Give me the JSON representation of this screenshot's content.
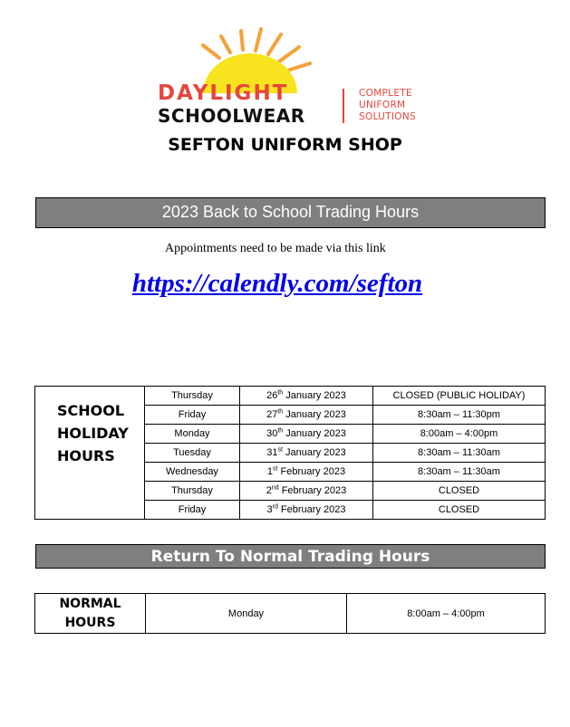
{
  "logo": {
    "brand_line1": "DAYLIGHT",
    "brand_line2": "SCHOOLWEAR",
    "tagline": [
      "COMPLETE",
      "UNIFORM",
      "SOLUTIONS"
    ],
    "colors": {
      "sun": "#f7e41f",
      "rays": "#f4a23a",
      "brand": "#e8453c"
    }
  },
  "shop_title": "SEFTON UNIFORM SHOP",
  "banner_trading": "2023 Back to School Trading Hours",
  "appointment_note": "Appointments need to be made via this link",
  "booking_link": "https://calendly.com/sefton",
  "holiday_hours": {
    "header_lines": [
      "SCHOOL",
      "HOLIDAY",
      "HOURS"
    ],
    "rows": [
      {
        "day": "Thursday",
        "date_day": "26",
        "date_suffix": "th",
        "date_rest": " January 2023",
        "hours": "CLOSED (PUBLIC HOLIDAY)"
      },
      {
        "day": "Friday",
        "date_day": "27",
        "date_suffix": "th",
        "date_rest": " January 2023",
        "hours": "8:30am – 11:30pm"
      },
      {
        "day": "Monday",
        "date_day": "30",
        "date_suffix": "th",
        "date_rest": " January 2023",
        "hours": "8:00am – 4:00pm"
      },
      {
        "day": "Tuesday",
        "date_day": "31",
        "date_suffix": "st",
        "date_rest": " January 2023",
        "hours": "8:30am – 11:30am"
      },
      {
        "day": "Wednesday",
        "date_day": "1",
        "date_suffix": "st",
        "date_rest": " February 2023",
        "hours": "8:30am – 11:30am"
      },
      {
        "day": "Thursday",
        "date_day": "2",
        "date_suffix": "nd",
        "date_rest": " February 2023",
        "hours": "CLOSED"
      },
      {
        "day": "Friday",
        "date_day": "3",
        "date_suffix": "rd",
        "date_rest": " February 2023",
        "hours": "CLOSED"
      }
    ]
  },
  "banner_normal": "Return To Normal Trading Hours",
  "normal_hours": {
    "header_lines": [
      "NORMAL",
      "HOURS"
    ],
    "day": "Monday",
    "hours": "8:00am – 4:00pm"
  },
  "colors": {
    "banner_bg": "#7f7f7f",
    "link": "#0000ee"
  }
}
